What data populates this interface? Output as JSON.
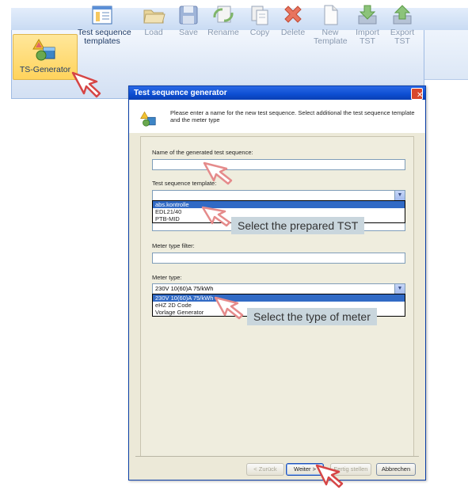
{
  "ribbon": {
    "ts_generator_label": "TS-Generator",
    "buttons": [
      {
        "label1": "Test sequence",
        "label2": "templates",
        "icon": "template-window-icon"
      },
      {
        "label1": "Load",
        "label2": "",
        "icon": "folder-icon"
      },
      {
        "label1": "Save",
        "label2": "",
        "icon": "floppy-disk-icon"
      },
      {
        "label1": "Rename",
        "label2": "",
        "icon": "rename-icon"
      },
      {
        "label1": "Copy",
        "label2": "",
        "icon": "copy-icon"
      },
      {
        "label1": "Delete",
        "label2": "",
        "icon": "delete-x-icon"
      },
      {
        "label1": "New",
        "label2": "Template",
        "icon": "new-document-icon"
      },
      {
        "label1": "Import",
        "label2": "TST",
        "icon": "import-arrow-icon"
      },
      {
        "label1": "Export",
        "label2": "TST",
        "icon": "export-arrow-icon"
      }
    ]
  },
  "dialog": {
    "title": "Test sequence generator",
    "close": "✕",
    "header_text": "Please enter a name for the new test sequence. Select additional the test sequence template and the meter type",
    "name_label": "Name of the generated test sequence:",
    "name_value": "",
    "template_label": "Test sequence template:",
    "template_value": "",
    "template_options": [
      "abs.kontrolle",
      "EDL21/40",
      "PTB-MID"
    ],
    "filter_label": "Meter type filter:",
    "filter_value": "",
    "meter_label": "Meter type:",
    "meter_value": "230V 10(60)A 75/kWh",
    "meter_options": [
      "230V 10(60)A 75/kWh",
      "eHZ 2D Code",
      "Vorlage Generator"
    ],
    "buttons": {
      "back": "< Zurück",
      "next": "Weiter >",
      "finish": "Fertig stellen",
      "cancel": "Abbrechen"
    }
  },
  "callouts": {
    "tst": "Select the prepared TST",
    "meter": "Select the type of meter"
  }
}
